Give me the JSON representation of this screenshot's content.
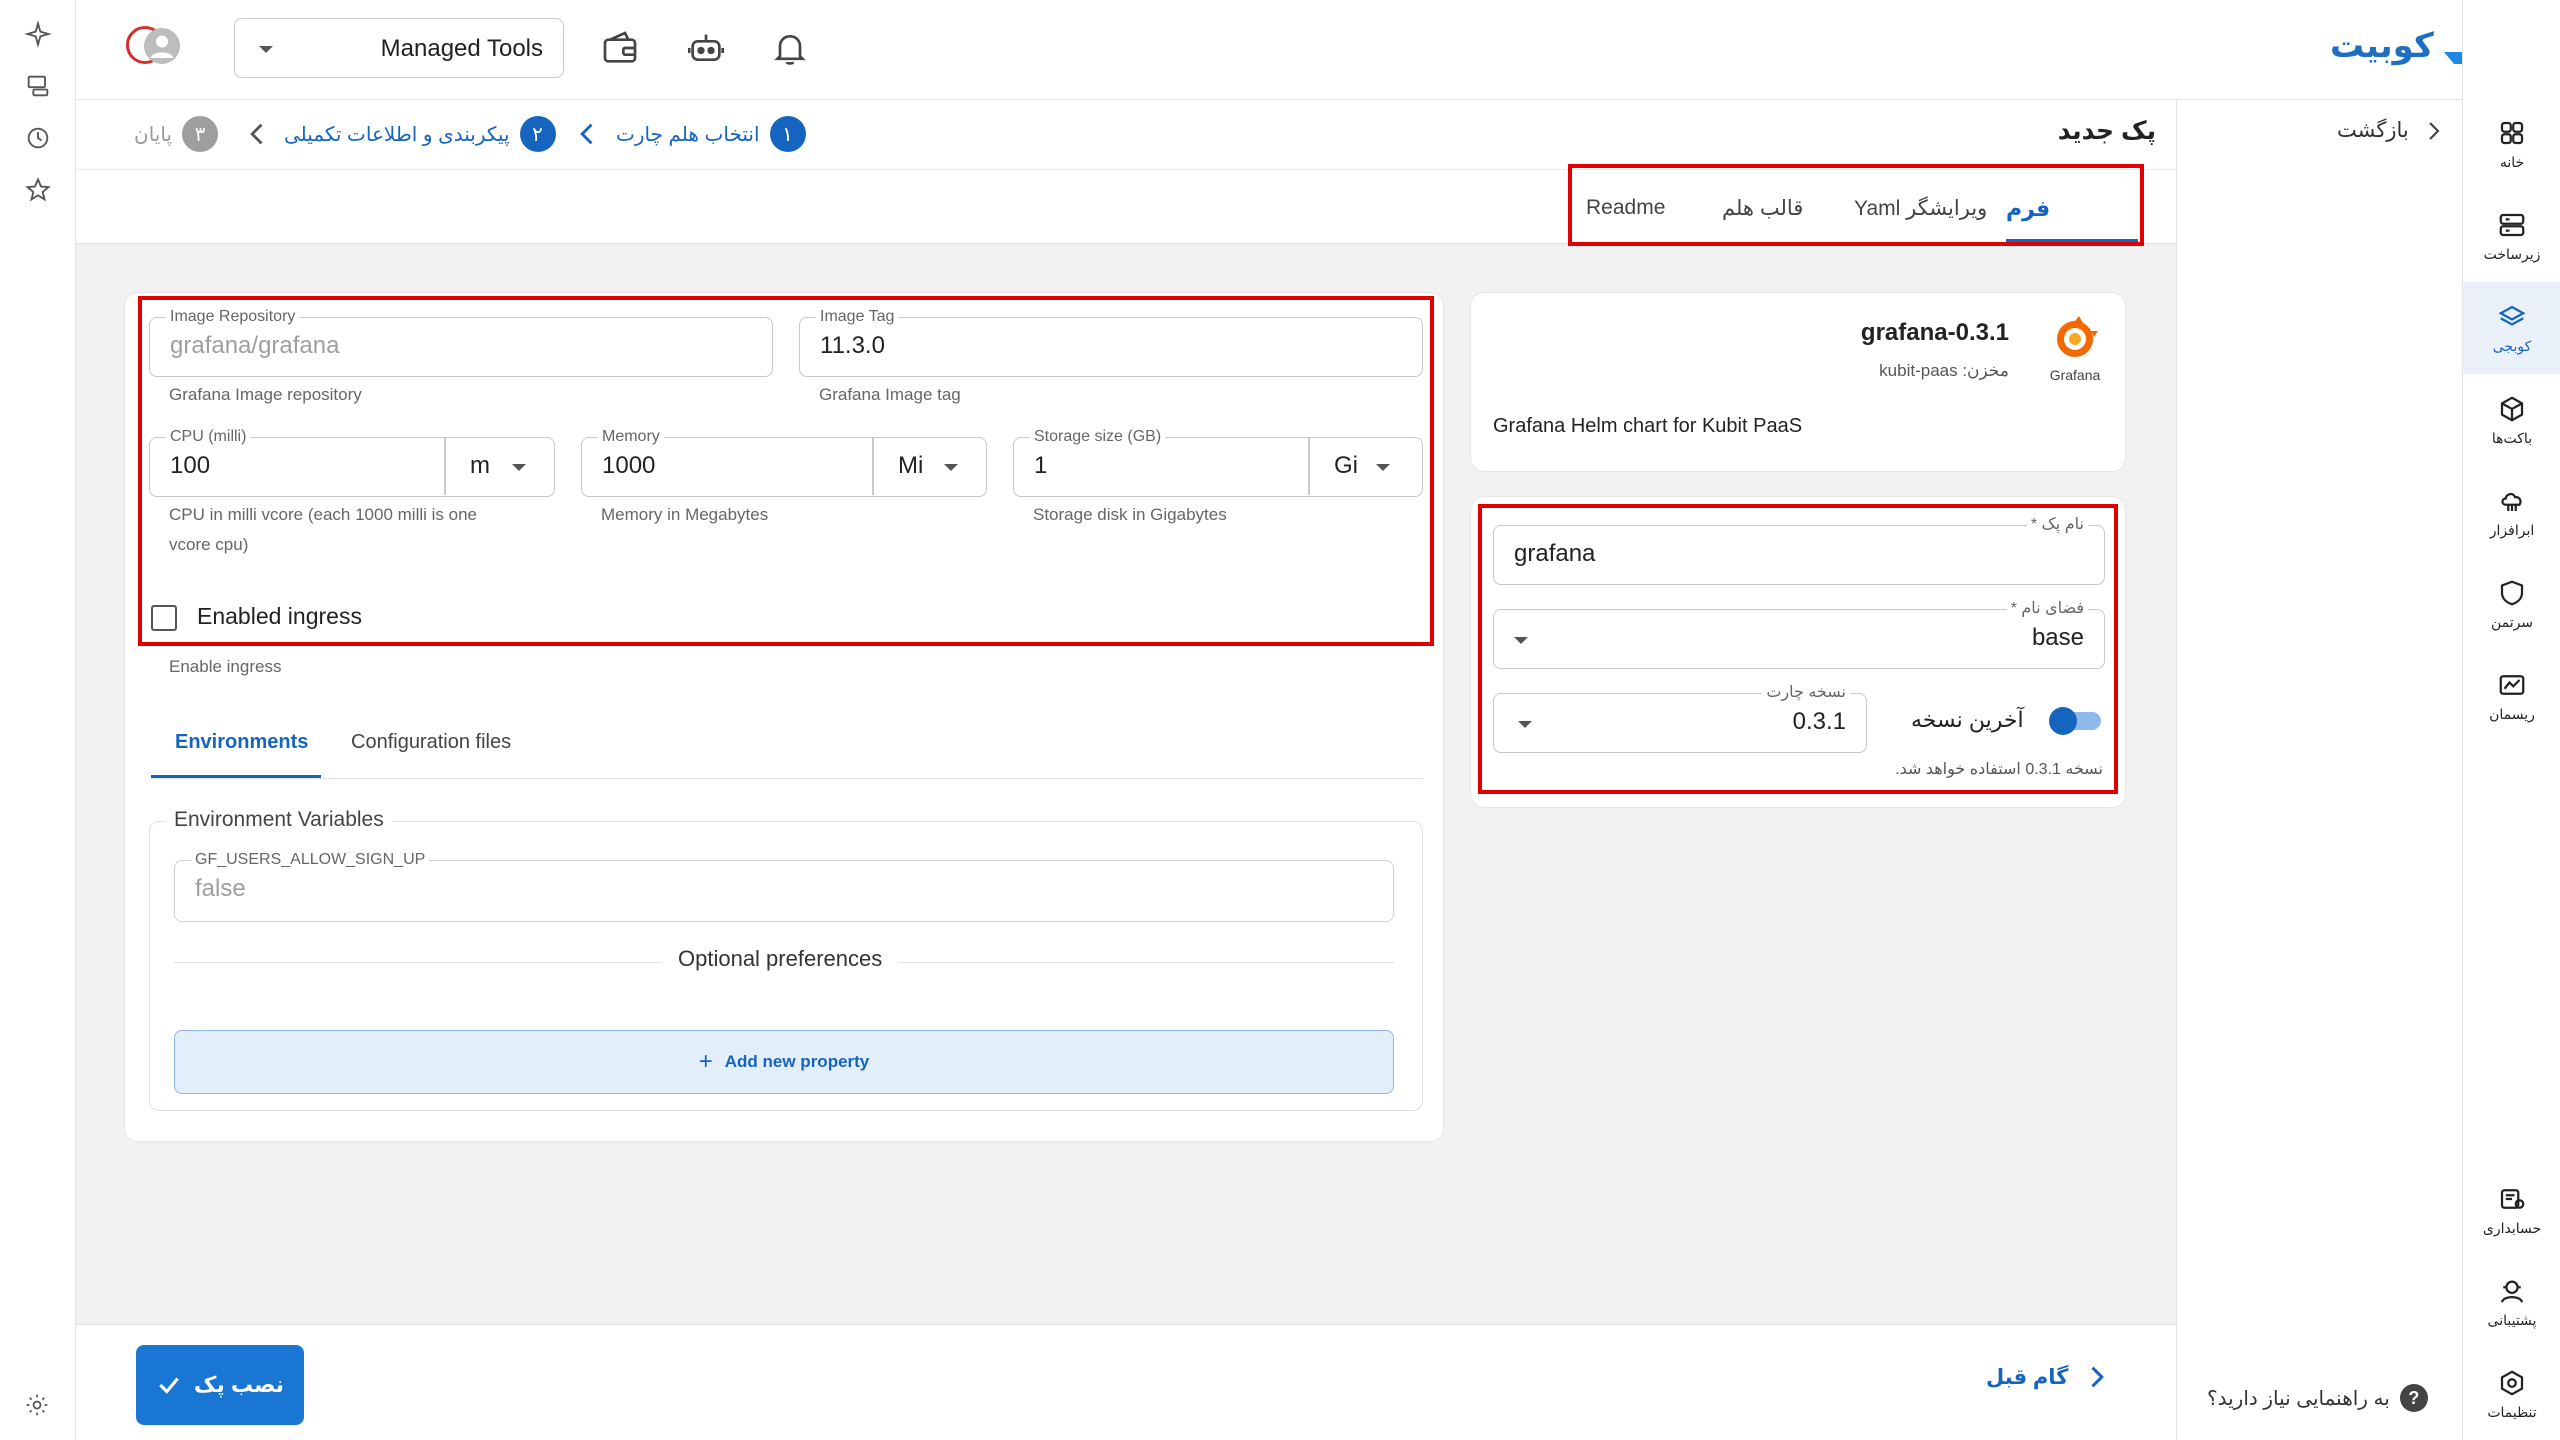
{
  "header": {
    "brand": "کوبیت",
    "workspace_select": "Managed Tools"
  },
  "breadcrumb": {
    "steps": [
      {
        "number": "۱",
        "label": "انتخاب هلم چارت"
      },
      {
        "number": "۲",
        "label": "پیکربندی و اطلاعات تکمیلی"
      },
      {
        "number": "۳",
        "label": "پایان"
      }
    ]
  },
  "page": {
    "title": "پک جدید",
    "back_label": "بازگشت"
  },
  "tabs": [
    {
      "label": "فرم"
    },
    {
      "label": "ویرایشگر Yaml"
    },
    {
      "label": "قالب هلم"
    },
    {
      "label": "Readme"
    }
  ],
  "chart_info": {
    "name": "grafana-0.3.1",
    "repository": "مخزن: kubit-paas",
    "logo_text": "Grafana",
    "description": "Grafana Helm chart for Kubit PaaS"
  },
  "pack_form": {
    "pack_name_label": "نام پک *",
    "pack_name_value": "grafana",
    "namespace_label": "فضای نام *",
    "namespace_value": "base",
    "chart_version_label": "نسخه چارت",
    "chart_version_value": "0.3.1",
    "latest_label": "آخرین نسخه",
    "latest_enabled": true,
    "version_note": "نسخه 0.3.1 استفاده خواهد شد."
  },
  "values_form": {
    "image_repository": {
      "label": "Image Repository",
      "placeholder": "grafana/grafana",
      "helper": "Grafana Image repository"
    },
    "image_tag": {
      "label": "Image Tag",
      "value": "11.3.0",
      "helper": "Grafana Image tag"
    },
    "cpu": {
      "label": "CPU (milli)",
      "value": "100",
      "unit": "m",
      "helper_line1": "CPU in milli vcore (each 1000 milli is one",
      "helper_line2": "vcore cpu)"
    },
    "memory": {
      "label": "Memory",
      "value": "1000",
      "unit": "Mi",
      "helper": "Memory in Megabytes"
    },
    "storage": {
      "label": "Storage size (GB)",
      "value": "1",
      "unit": "Gi",
      "helper": "Storage disk in Gigabytes"
    },
    "ingress": {
      "label": "Enabled ingress",
      "helper": "Enable ingress",
      "checked": false
    }
  },
  "sub_tabs": [
    {
      "label": "Environments"
    },
    {
      "label": "Configuration files"
    }
  ],
  "environment": {
    "section_title": "Environment Variables",
    "var_name": "GF_USERS_ALLOW_SIGN_UP",
    "var_value": "false",
    "optional_title": "Optional preferences",
    "add_property": "Add new property"
  },
  "footer": {
    "install_button": "نصب پک",
    "prev_step": "گام قبل",
    "help_text": "به راهنمایی نیاز دارید؟"
  },
  "nav": [
    {
      "label": "خانه",
      "icon": "home-grid-icon"
    },
    {
      "label": "زیرساخت",
      "icon": "server-icon"
    },
    {
      "label": "کوبجی",
      "icon": "layers-icon",
      "active": true
    },
    {
      "label": "باکت‌ها",
      "icon": "box-icon"
    },
    {
      "label": "ابرافزار",
      "icon": "cloud-app-icon"
    },
    {
      "label": "سرتمن",
      "icon": "shield-icon"
    },
    {
      "label": "ریسمان",
      "icon": "pipeline-icon"
    },
    {
      "label": "حسابداری",
      "icon": "billing-icon"
    },
    {
      "label": "پشتیبانی",
      "icon": "support-icon"
    },
    {
      "label": "تنظیمات",
      "icon": "settings-icon"
    }
  ],
  "colors": {
    "primary": "#1565c0",
    "highlight": "#e00000",
    "add_property_bg": "#e3eefb"
  }
}
